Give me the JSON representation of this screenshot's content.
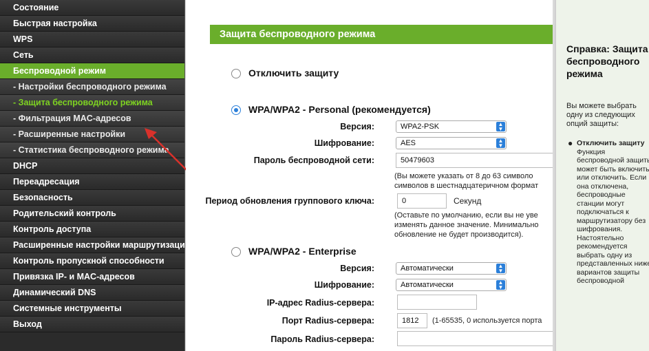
{
  "sidebar": {
    "items": [
      {
        "label": "Состояние"
      },
      {
        "label": "Быстрая настройка"
      },
      {
        "label": "WPS"
      },
      {
        "label": "Сеть"
      },
      {
        "label": "Беспроводной режим"
      },
      {
        "label": "- Настройки беспроводного режима"
      },
      {
        "label": "- Защита беспроводного режима"
      },
      {
        "label": "- Фильтрация MAC-адресов"
      },
      {
        "label": "- Расширенные настройки"
      },
      {
        "label": "- Статистика беспроводного режима"
      },
      {
        "label": "DHCP"
      },
      {
        "label": "Переадресация"
      },
      {
        "label": "Безопасность"
      },
      {
        "label": "Родительский контроль"
      },
      {
        "label": "Контроль доступа"
      },
      {
        "label": "Расширенные настройки маршрутизации"
      },
      {
        "label": "Контроль пропускной способности"
      },
      {
        "label": "Привязка IP- и MAC-адресов"
      },
      {
        "label": "Динамический DNS"
      },
      {
        "label": "Системные инструменты"
      },
      {
        "label": "Выход"
      }
    ]
  },
  "main": {
    "title": "Защита беспроводного режима",
    "disable": {
      "label": "Отключить защиту"
    },
    "personal": {
      "label": "WPA/WPA2 - Personal (рекомендуется)",
      "version_label": "Версия:",
      "version_value": "WPA2-PSK",
      "encryption_label": "Шифрование:",
      "encryption_value": "AES",
      "password_label": "Пароль беспроводной сети:",
      "password_value": "50479603",
      "password_note_1": "(Вы можете указать от 8 до 63 символо",
      "password_note_2": "символов в шестнадцатеричном формат",
      "group_key_label": "Период обновления группового ключа:",
      "group_key_value": "0",
      "group_key_unit": "Секунд",
      "group_note_1": "(Оставьте по умолчанию, если вы не уве",
      "group_note_2": "изменять данное значение. Минимально",
      "group_note_3": "обновление не будет производится)."
    },
    "enterprise": {
      "label": "WPA/WPA2 - Enterprise",
      "version_label": "Версия:",
      "version_value": "Автоматически",
      "encryption_label": "Шифрование:",
      "encryption_value": "Автоматически",
      "radius_ip_label": "IP-адрес Radius-сервера:",
      "radius_ip_value": "",
      "radius_port_label": "Порт Radius-сервера:",
      "radius_port_value": "1812",
      "radius_port_note": "(1-65535, 0 используется порта",
      "radius_pass_label": "Пароль Radius-сервера:",
      "radius_pass_value": ""
    }
  },
  "help": {
    "title": "Справка: Защита беспроводного режима",
    "intro": "Вы можете выбрать одну из следующих опций защиты:",
    "bullet_title": "Отключить защиту",
    "bullet_text": "Функция беспроводной защиты может быть включить или отключить. Если она отключена, беспроводные станции могут подключаться к маршрутизатору без шифрования. Настоятельно рекомендуется выбрать одну из представленных ниже вариантов защиты беспроводной"
  },
  "colors": {
    "accent_green": "#6aae2b",
    "sidebar_bg": "#2b2b2b",
    "select_blue": "#2b7fd9",
    "arrow_red": "#d9312b"
  }
}
